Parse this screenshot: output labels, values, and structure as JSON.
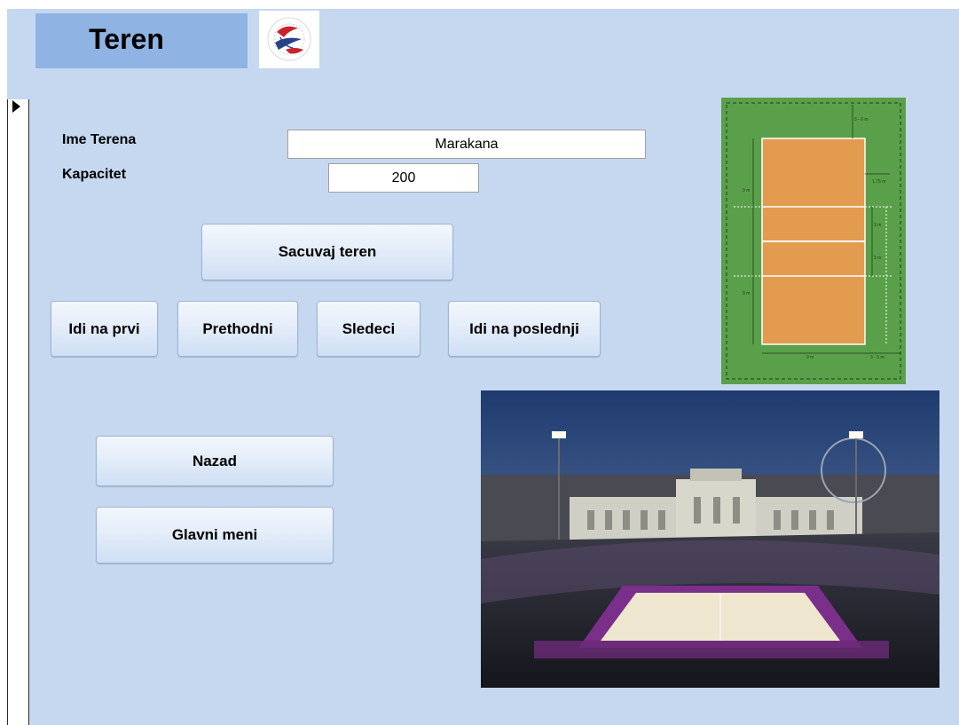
{
  "form": {
    "title": "Teren",
    "fields": {
      "name_label": "Ime Terena",
      "name_value": "Marakana",
      "capacity_label": "Kapacitet",
      "capacity_value": "200"
    },
    "buttons": {
      "save": "Sacuvaj teren",
      "first": "Idi na prvi",
      "previous": "Prethodni",
      "next": "Sledeci",
      "last": "Idi na poslednji",
      "back": "Nazad",
      "main_menu": "Glavni meni"
    },
    "court_diagram": {
      "dimensions": [
        "3 - 6 m",
        "1.75 m",
        "3 m",
        "3 m",
        "9 m",
        "9 m",
        "9 m",
        "3 - 5 m"
      ]
    }
  },
  "colors": {
    "form_background": "#c6d8f0",
    "title_background": "#8fb4e3",
    "court_surface": "#e39b4f",
    "court_surround": "#5aa04a"
  }
}
